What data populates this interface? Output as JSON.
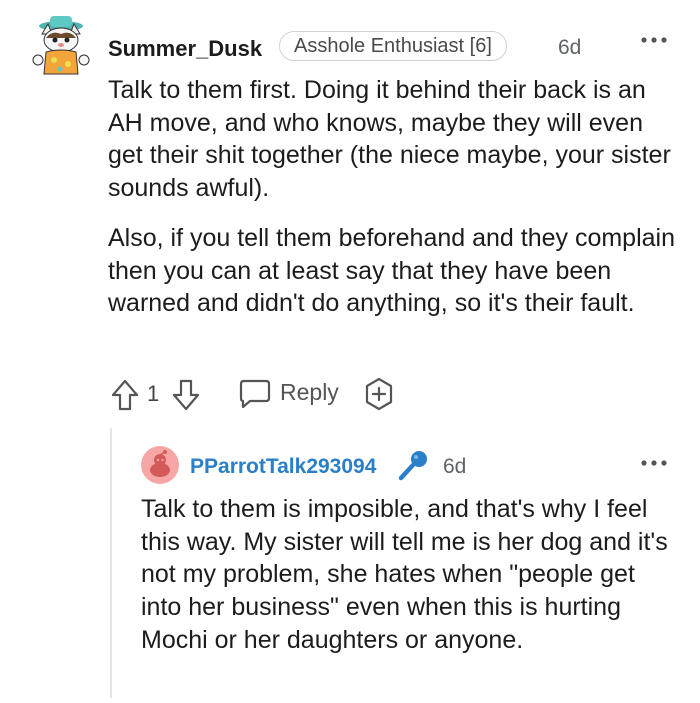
{
  "comment": {
    "username": "Summer_Dusk",
    "flair": "Asshole Enthusiast [6]",
    "time": "6d",
    "avatar_icon": "cartoon-cat-avatar-icon",
    "paragraphs": [
      "Talk to them first. Doing it behind their back is an AH move, and who knows, maybe they will even get their shit together (the niece maybe, your sister sounds awful).",
      "Also, if you tell them beforehand and they complain then you can at least say that they have been warned and didn't do anything, so it's their fault."
    ],
    "vote_count": "1",
    "reply_label": "Reply"
  },
  "reply": {
    "username": "PParrotTalk293094",
    "time": "6d",
    "avatar_icon": "default-reddit-avatar-icon",
    "paragraphs": [
      "Talk to them is imposible, and that's why I feel this way. My sister will tell me is her dog and it's not my problem, she hates when \"people get into her business\" even when this is hurting Mochi or her daughters or anyone."
    ]
  },
  "colors": {
    "username_link": "#2b7fc9",
    "muted": "#5f6368",
    "avatar_pink": "#f7a6a6",
    "mic_blue": "#2b7fc9"
  }
}
